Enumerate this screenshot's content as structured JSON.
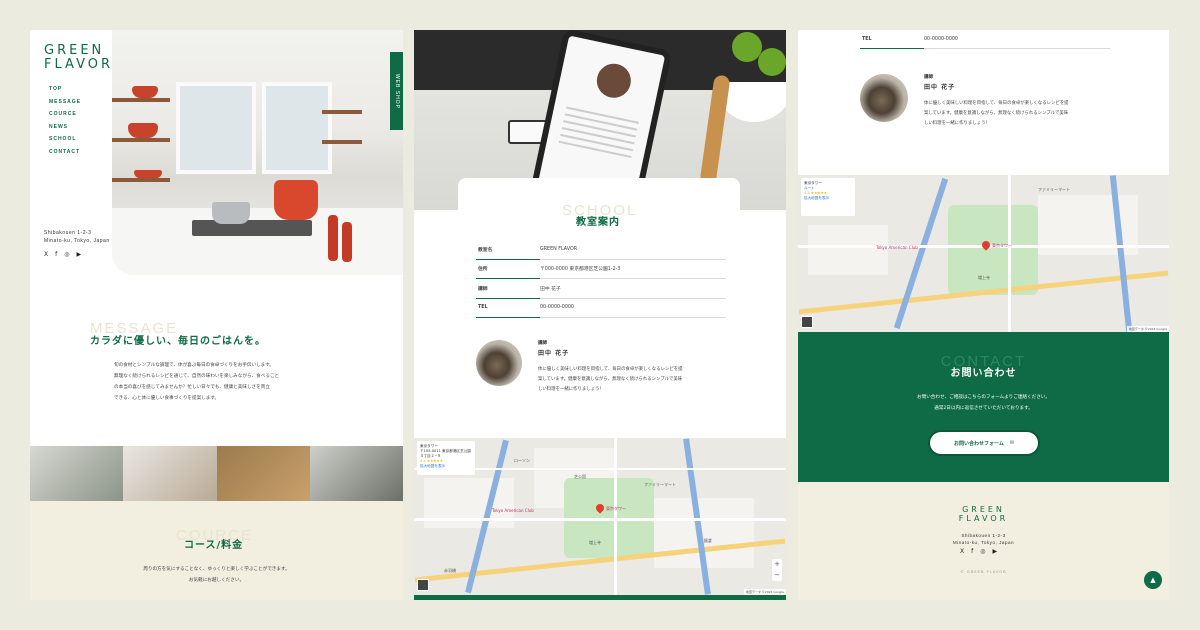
{
  "brand": {
    "logo_line1": "GREEN",
    "logo_line2": "FLAVOR"
  },
  "colors": {
    "accent": "#0f6b45",
    "background": "#ecebe0",
    "beige": "#f2efe0"
  },
  "nav": {
    "items": [
      "TOP",
      "MESSAGE",
      "COURCE",
      "NEWS",
      "SCHOOL",
      "CONTACT"
    ],
    "webshop": "WEB SHOP"
  },
  "address": {
    "line1": "Shibakouen 1-2-3",
    "line2": "Minato-ku, Tokyo, Japan"
  },
  "social": {
    "icons": [
      "x-icon",
      "facebook-icon",
      "instagram-icon",
      "youtube-icon"
    ],
    "x": "X",
    "facebook": "f",
    "instagram": "◎",
    "youtube": "▶"
  },
  "message": {
    "en": "MESSAGE",
    "heading": "カラダに優しい、毎日のごはんを。",
    "body": [
      "旬の食材とシンプルな調理で、体が喜ぶ毎日の食卓づくりをお手伝いします。",
      "無理なく続けられるレシピを通じて、自然の味わいを楽しみながら、食べること",
      "の本当の喜びを感じてみませんか？忙しい日々でも、健康と美味しさを両立",
      "できる、心と体に優しい食事づくりを提案します。"
    ]
  },
  "course": {
    "en": "COURCE",
    "heading": "コース/料金",
    "body": [
      "周りの方を気にすることなく、ゆっくりと楽しく学ぶことができます。",
      "お気軽にお越しください。"
    ]
  },
  "school": {
    "en": "SCHOOL",
    "heading": "教室案内",
    "rows": [
      {
        "label": "教室名",
        "value": "GREEN FLAVOR"
      },
      {
        "label": "住所",
        "value": "〒000-0000 東京都港区芝公園1-2-3"
      },
      {
        "label": "講師",
        "value": "田中 花子"
      },
      {
        "label": "TEL",
        "value": "00-0000-0000"
      }
    ]
  },
  "teacher": {
    "role": "講師",
    "name": "田中 花子",
    "desc": [
      "体に優しく美味しい料理を目指して、毎日の食卓が楽しくなるレシピを提",
      "案しています。健康を意識しながら、無理なく続けられるシンプルで美味",
      "しい料理を一緒に作りましょう！"
    ]
  },
  "map": {
    "place": "東京タワー",
    "address": "〒105-0011 東京都港区芝公園４丁目２−８",
    "rating": "4.5 ★★★★★",
    "route": "ルート",
    "larger": "拡大地図を表示",
    "pin_label": "東京タワー",
    "labels": [
      "Tokyo American Club",
      "ローソン",
      "ファミリーマート",
      "増上寺",
      "芝公園",
      "飯倉",
      "赤羽橋"
    ],
    "zoom_in": "+",
    "zoom_out": "−",
    "attribution": "地図データ ©2024 Google"
  },
  "contact": {
    "en": "CONTACT",
    "heading": "お問い合わせ",
    "body": [
      "お問い合わせ、ご相談はこちらのフォームよりご連絡ください。",
      "通常2日以内に返信させていただいております。"
    ],
    "button": "お問い合わせフォーム",
    "button_icon": "✉"
  },
  "footer": {
    "copyright": "© GREEN FLAVOR",
    "totop": "▲"
  }
}
